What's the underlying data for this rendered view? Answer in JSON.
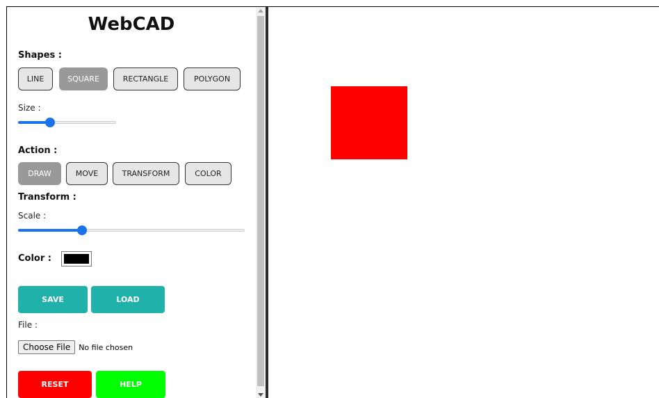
{
  "app": {
    "title": "WebCAD"
  },
  "shapes": {
    "heading": "Shapes :",
    "buttons": [
      "LINE",
      "SQUARE",
      "RECTANGLE",
      "POLYGON"
    ],
    "active": "SQUARE"
  },
  "size": {
    "label": "Size :",
    "value": 0.3
  },
  "action": {
    "heading": "Action :",
    "buttons": [
      "DRAW",
      "MOVE",
      "TRANSFORM",
      "COLOR"
    ],
    "active": "DRAW"
  },
  "transform": {
    "heading": "Transform :",
    "scale_label": "Scale :",
    "scale_value": 0.28
  },
  "color": {
    "label": "Color :",
    "value": "#000000"
  },
  "io": {
    "save_label": "SAVE",
    "load_label": "LOAD"
  },
  "file": {
    "label": "File :",
    "button_label": "Choose File",
    "status": "No file chosen"
  },
  "footer": {
    "reset_label": "RESET",
    "help_label": "HELP"
  },
  "canvas": {
    "shape": "square",
    "shape_color": "#ff0000"
  },
  "colors": {
    "teal": "#20b2aa",
    "reset": "#ff0000",
    "help": "#00ff00",
    "active_button": "#999999"
  }
}
